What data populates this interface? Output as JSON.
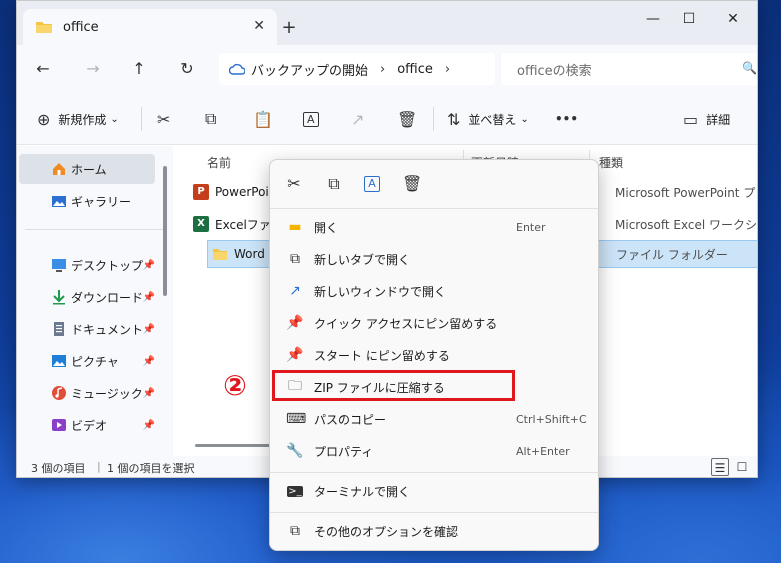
{
  "window": {
    "tab_title": "office",
    "tab_close": "✕",
    "new_tab": "+",
    "minimize": "—",
    "maximize": "☐",
    "close": "✕"
  },
  "addressbar": {
    "back": "←",
    "forward": "→",
    "up": "↑",
    "refresh": "↻",
    "crumbs": [
      "バックアップの開始",
      "office"
    ],
    "sep": "›",
    "search_placeholder": "officeの検索",
    "search_icon": "🔍"
  },
  "toolbar": {
    "new_label": "新規作成",
    "new_icon": "⊕",
    "chevron": "⌄",
    "cut_icon": "✂",
    "copy_icon": "⧉",
    "paste_icon": "📋",
    "rename_icon": "A",
    "share_icon": "↗",
    "delete_icon": "🗑",
    "sort_label": "並べ替え",
    "sort_icon": "⇅",
    "more_icon": "•••",
    "details_label": "詳細",
    "details_icon": "▭"
  },
  "sidebar": {
    "items": [
      {
        "label": "ホーム",
        "icon": "home-icon",
        "active": true
      },
      {
        "label": "ギャラリー",
        "icon": "gallery-icon",
        "active": false
      },
      {
        "label": "デスクトップ",
        "icon": "desktop-icon",
        "pinned": true
      },
      {
        "label": "ダウンロード",
        "icon": "download-icon",
        "pinned": true
      },
      {
        "label": "ドキュメント",
        "icon": "documents-icon",
        "pinned": true
      },
      {
        "label": "ピクチャ",
        "icon": "pictures-icon",
        "pinned": true
      },
      {
        "label": "ミュージック",
        "icon": "music-icon",
        "pinned": true
      },
      {
        "label": "ビデオ",
        "icon": "video-icon",
        "pinned": true
      }
    ],
    "pin_glyph": "📌"
  },
  "main": {
    "columns": {
      "name": "名前",
      "date": "更新日時",
      "type": "種類"
    },
    "files": [
      {
        "name": "PowerPoin",
        "type": "Microsoft PowerPoint プレゼンテ",
        "icon": "powerpoint-icon",
        "icon_letter": "P",
        "color": "#c43e1c"
      },
      {
        "name": "Excelファイル",
        "type": "Microsoft Excel ワークシート",
        "icon": "excel-icon",
        "icon_letter": "X",
        "color": "#1d6f42"
      },
      {
        "name": "Word",
        "type": "ファイル フォルダー",
        "icon": "folder-icon",
        "icon_letter": "",
        "color": "#f4c542",
        "selected": true
      }
    ]
  },
  "statusbar": {
    "item_count": "3 個の項目",
    "selected": "1 個の項目を選択",
    "view_details": "☰",
    "view_large": "☐"
  },
  "context_menu": {
    "top_icons": [
      "✂",
      "⧉",
      "A",
      "🗑"
    ],
    "items": [
      {
        "label": "開く",
        "shortcut": "Enter",
        "icon": "▬"
      },
      {
        "label": "新しいタブで開く",
        "shortcut": "",
        "icon": "⧉"
      },
      {
        "label": "新しいウィンドウで開く",
        "shortcut": "",
        "icon": "↗"
      },
      {
        "label": "クイック アクセスにピン留めする",
        "shortcut": "",
        "icon": "📌"
      },
      {
        "label": "スタート にピン留めする",
        "shortcut": "",
        "icon": "📌"
      },
      {
        "label": "ZIP ファイルに圧縮する",
        "shortcut": "",
        "icon": "🗀"
      },
      {
        "label": "パスのコピー",
        "shortcut": "Ctrl+Shift+C",
        "icon": "⌨"
      },
      {
        "label": "プロパティ",
        "shortcut": "Alt+Enter",
        "icon": "🔧"
      },
      {
        "label": "ターミナルで開く",
        "shortcut": "",
        "icon": ">_"
      },
      {
        "label": "その他のオプションを確認",
        "shortcut": "",
        "icon": "⧉"
      }
    ]
  },
  "annotation": {
    "step": "②",
    "color": "#e0181e"
  }
}
